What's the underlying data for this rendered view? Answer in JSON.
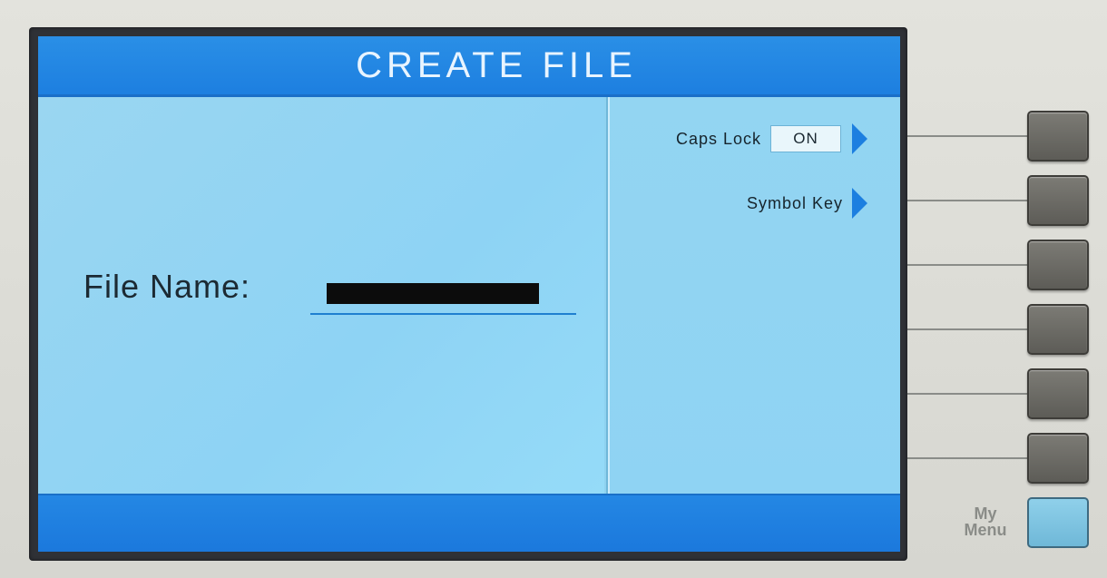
{
  "header": {
    "title": "CREATE FILE"
  },
  "main": {
    "file_name_label": "File Name:",
    "file_name_value": ""
  },
  "softkeys": [
    {
      "label": "Caps Lock",
      "state": "ON"
    },
    {
      "label": "Symbol Key"
    }
  ],
  "hardware": {
    "my_menu_label_line1": "My",
    "my_menu_label_line2": "Menu"
  },
  "colors": {
    "screen_bg": "#8fd2f0",
    "title_bar": "#1d7fe0",
    "arrow": "#1c7fe0",
    "my_menu_key": "#7cc4e2"
  }
}
